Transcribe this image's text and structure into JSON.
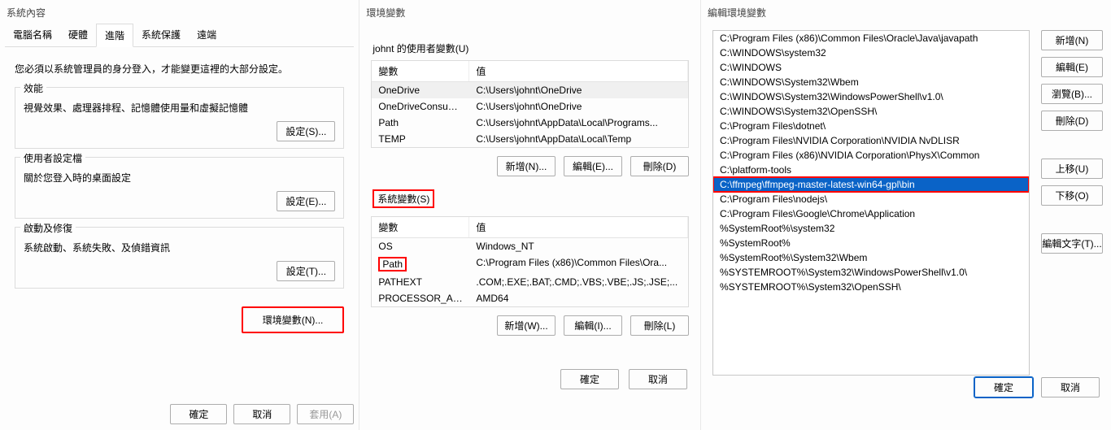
{
  "panel1": {
    "title": "系統內容",
    "tabs": [
      "電腦名稱",
      "硬體",
      "進階",
      "系統保護",
      "遠端"
    ],
    "activeTab": 2,
    "line": "您必須以系統管理員的身分登入，才能變更這裡的大部分設定。",
    "groups": [
      {
        "title": "效能",
        "desc": "視覺效果、處理器排程、記憶體使用量和虛擬記憶體",
        "btn": "設定(S)..."
      },
      {
        "title": "使用者設定檔",
        "desc": "關於您登入時的桌面設定",
        "btn": "設定(E)..."
      },
      {
        "title": "啟動及修復",
        "desc": "系統啟動、系統失敗、及偵錯資訊",
        "btn": "設定(T)..."
      }
    ],
    "envBtn": "環境變數(N)...",
    "footer": {
      "ok": "確定",
      "cancel": "取消",
      "apply": "套用(A)"
    }
  },
  "panel2": {
    "title": "環境變數",
    "userSection": "johnt 的使用者變數(U)",
    "colVar": "變數",
    "colVal": "值",
    "userVars": [
      {
        "k": "OneDrive",
        "v": "C:\\Users\\johnt\\OneDrive"
      },
      {
        "k": "OneDriveConsum...",
        "v": "C:\\Users\\johnt\\OneDrive"
      },
      {
        "k": "Path",
        "v": "C:\\Users\\johnt\\AppData\\Local\\Programs..."
      },
      {
        "k": "TEMP",
        "v": "C:\\Users\\johnt\\AppData\\Local\\Temp"
      }
    ],
    "sysSection": "系統變數(S)",
    "sysVars": [
      {
        "k": "OS",
        "v": "Windows_NT"
      },
      {
        "k": "Path",
        "v": "C:\\Program Files (x86)\\Common Files\\Ora..."
      },
      {
        "k": "PATHEXT",
        "v": ".COM;.EXE;.BAT;.CMD;.VBS;.VBE;.JS;.JSE;..."
      },
      {
        "k": "PROCESSOR_AR...",
        "v": "AMD64"
      }
    ],
    "btns": {
      "newN": "新增(N)...",
      "editE": "編輯(E)...",
      "delD": "刪除(D)",
      "newW": "新增(W)...",
      "editI": "編輯(I)...",
      "delL": "刪除(L)"
    },
    "footer": {
      "ok": "確定",
      "cancel": "取消"
    }
  },
  "panel3": {
    "title": "編輯環境變數",
    "items": [
      "C:\\Program Files (x86)\\Common Files\\Oracle\\Java\\javapath",
      "C:\\WINDOWS\\system32",
      "C:\\WINDOWS",
      "C:\\WINDOWS\\System32\\Wbem",
      "C:\\WINDOWS\\System32\\WindowsPowerShell\\v1.0\\",
      "C:\\WINDOWS\\System32\\OpenSSH\\",
      "C:\\Program Files\\dotnet\\",
      "C:\\Program Files\\NVIDIA Corporation\\NVIDIA NvDLISR",
      "C:\\Program Files (x86)\\NVIDIA Corporation\\PhysX\\Common",
      "C:\\platform-tools",
      "C:\\ffmpeg\\ffmpeg-master-latest-win64-gpl\\bin",
      "C:\\Program Files\\nodejs\\",
      "C:\\Program Files\\Google\\Chrome\\Application",
      "%SystemRoot%\\system32",
      "%SystemRoot%",
      "%SystemRoot%\\System32\\Wbem",
      "%SYSTEMROOT%\\System32\\WindowsPowerShell\\v1.0\\",
      "%SYSTEMROOT%\\System32\\OpenSSH\\"
    ],
    "selectedIndex": 10,
    "side": {
      "new": "新增(N)",
      "edit": "編輯(E)",
      "browse": "瀏覽(B)...",
      "del": "刪除(D)",
      "up": "上移(U)",
      "down": "下移(O)",
      "editText": "編輯文字(T)..."
    },
    "footer": {
      "ok": "確定",
      "cancel": "取消"
    }
  }
}
